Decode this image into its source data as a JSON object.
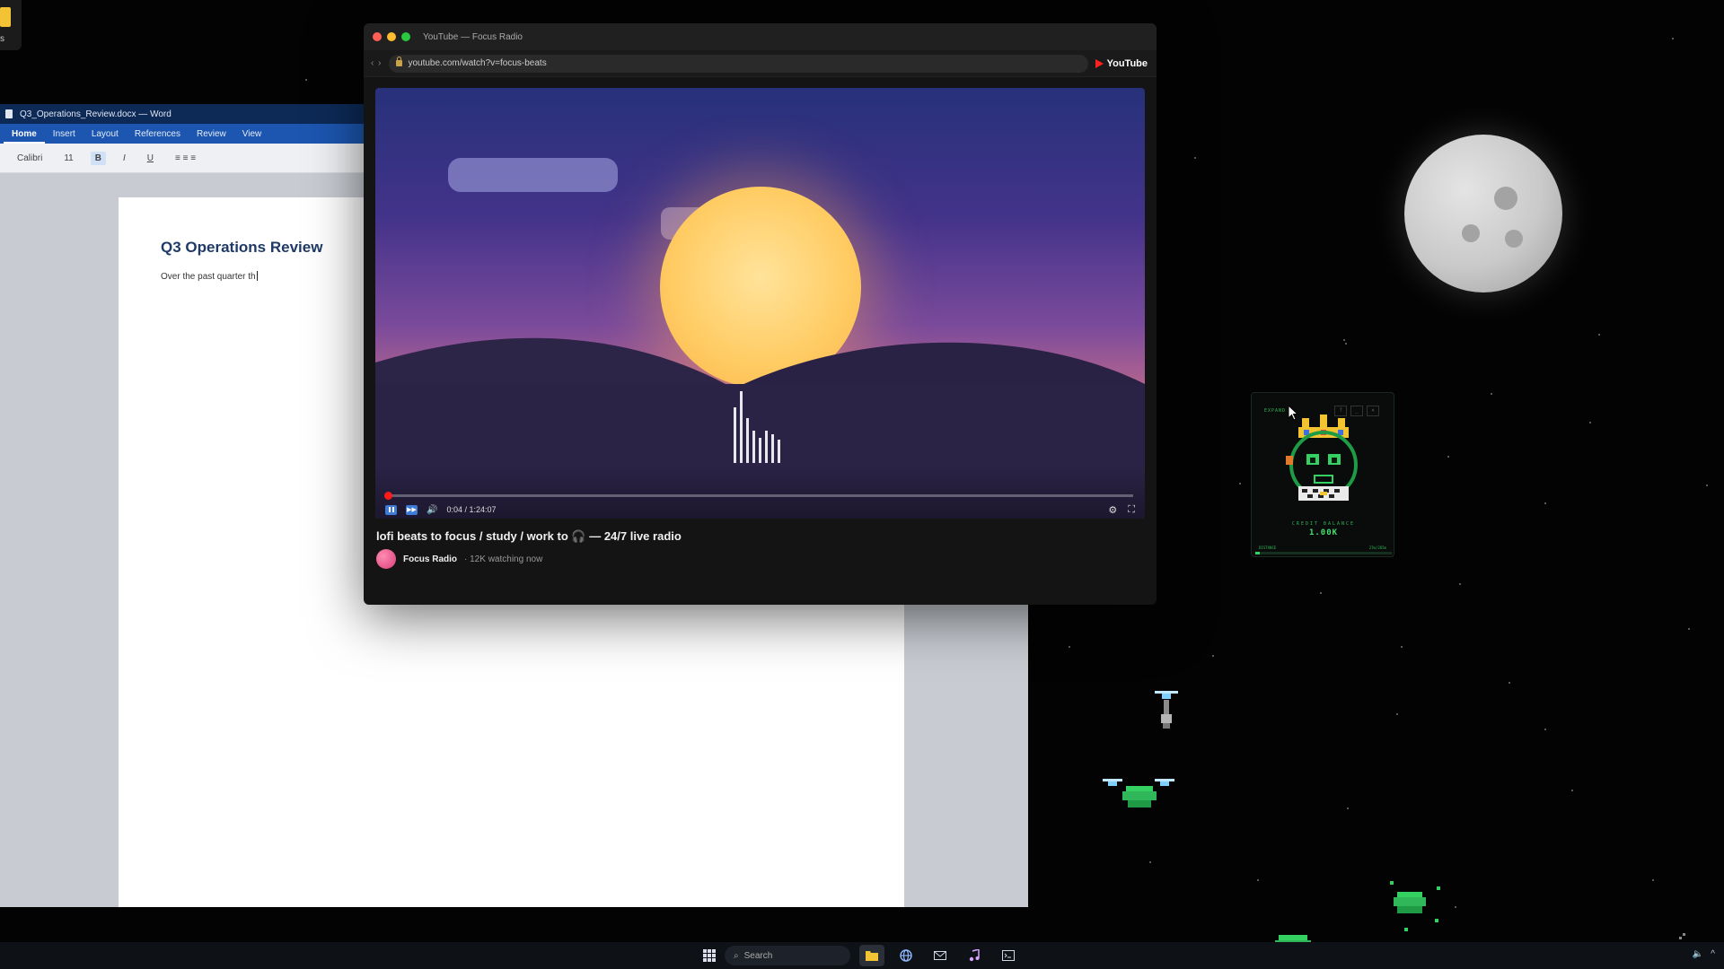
{
  "desktop": {
    "icon_label": "s"
  },
  "word": {
    "title": "Q3_Operations_Review.docx — Word",
    "tabs": [
      "Home",
      "Insert",
      "Layout",
      "References",
      "Review",
      "View"
    ],
    "ribbon": {
      "font": "Calibri",
      "size": "11",
      "bold": "B",
      "italic": "I",
      "underline": "U",
      "align": "≡ ≡ ≡"
    },
    "document": {
      "heading": "Q3 Operations Review",
      "body": "Over the past quarter th"
    }
  },
  "youtube": {
    "window_title": "YouTube — Focus Radio",
    "nav": "‹ ›",
    "url": "youtube.com/watch?v=focus-beats",
    "brand": "YouTube",
    "player": {
      "time": "0:04 / 1:24:07",
      "progress": 0.001
    },
    "video_title": "lofi beats to focus / study / work to 🎧 — 24/7 live radio",
    "channel": "Focus Radio",
    "watching": "· 12K watching now"
  },
  "game": {
    "label": "EXPAND",
    "buttons": [
      "?",
      "_",
      "×"
    ],
    "credit_label": "CREDIT BALANCE",
    "credit_value": "1.00K",
    "distance_label": "DISTANCE",
    "distance_value": "27m/265m",
    "distance_progress": 0.03
  },
  "taskbar": {
    "search_placeholder": "Search",
    "apps": [
      "file-explorer-icon",
      "browser-icon",
      "mail-icon",
      "music-icon",
      "terminal-icon"
    ]
  },
  "colors": {
    "word_accent": "#1c56b0",
    "youtube_red": "#ff1a1a",
    "game_green": "#35d062"
  }
}
